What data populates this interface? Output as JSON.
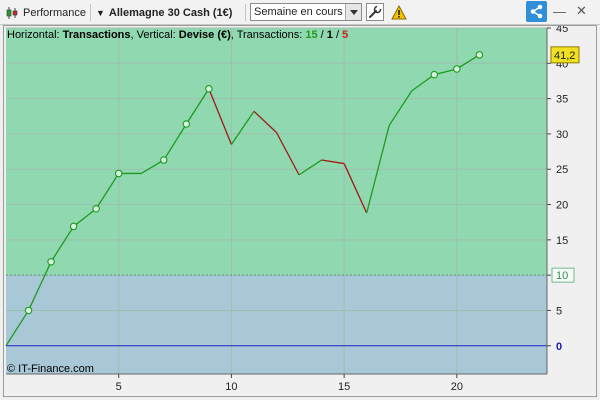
{
  "toolbar": {
    "performance_label": "Performance",
    "instrument_label": "Allemagne 30 Cash (1€)",
    "period_value": "Semaine en cours",
    "icons": [
      "candles-icon",
      "wrench-icon",
      "warning-icon",
      "share-icon",
      "minimize-icon",
      "close-icon"
    ]
  },
  "chart_header": {
    "h_prefix": "Horizontal: ",
    "h_value": "Transactions",
    "v_prefix": ", Vertical: ",
    "v_value": "Devise (€)",
    "t_prefix": ", Transactions: ",
    "t_win": "15",
    "t_sep1": " / ",
    "t_neutral": "1",
    "t_sep2": " / ",
    "t_loss": "5"
  },
  "watermark": "© IT-Finance.com",
  "colors": {
    "gain": "#1e9a1e",
    "loss": "#a01818",
    "zero_line": "#2222cc",
    "upper_zone": "#8fd8b0",
    "lower_zone": "#a8c8d8",
    "current_label": "#f0e020"
  },
  "chart_data": {
    "type": "line",
    "xlabel": "",
    "ylabel": "",
    "x_ticks": [
      "5",
      "10",
      "15",
      "20"
    ],
    "y_ticks": [
      "0",
      "5",
      "10",
      "15",
      "20",
      "25",
      "30",
      "35",
      "40",
      "45"
    ],
    "xlim": [
      0,
      24
    ],
    "ylim": [
      -4,
      45
    ],
    "threshold": 10,
    "threshold_label": "10",
    "current_value": 41.2,
    "current_label": "41,2",
    "zero_label": "0",
    "series": [
      {
        "x": [
          0,
          1,
          2,
          3,
          4,
          5,
          6,
          7,
          8,
          9,
          10,
          11,
          12,
          13,
          14,
          15,
          16,
          17,
          18,
          19,
          20,
          21
        ],
        "y": [
          0,
          5,
          11.9,
          16.9,
          19.4,
          24.4,
          24.4,
          26.3,
          31.4,
          36.4,
          28.5,
          33.2,
          30.2,
          24.2,
          26.3,
          25.8,
          18.8,
          31.2,
          36.1,
          38.4,
          39.2,
          41.2
        ],
        "markers": [
          1,
          2,
          3,
          4,
          5,
          7,
          8,
          9,
          19,
          20,
          21
        ]
      }
    ]
  }
}
